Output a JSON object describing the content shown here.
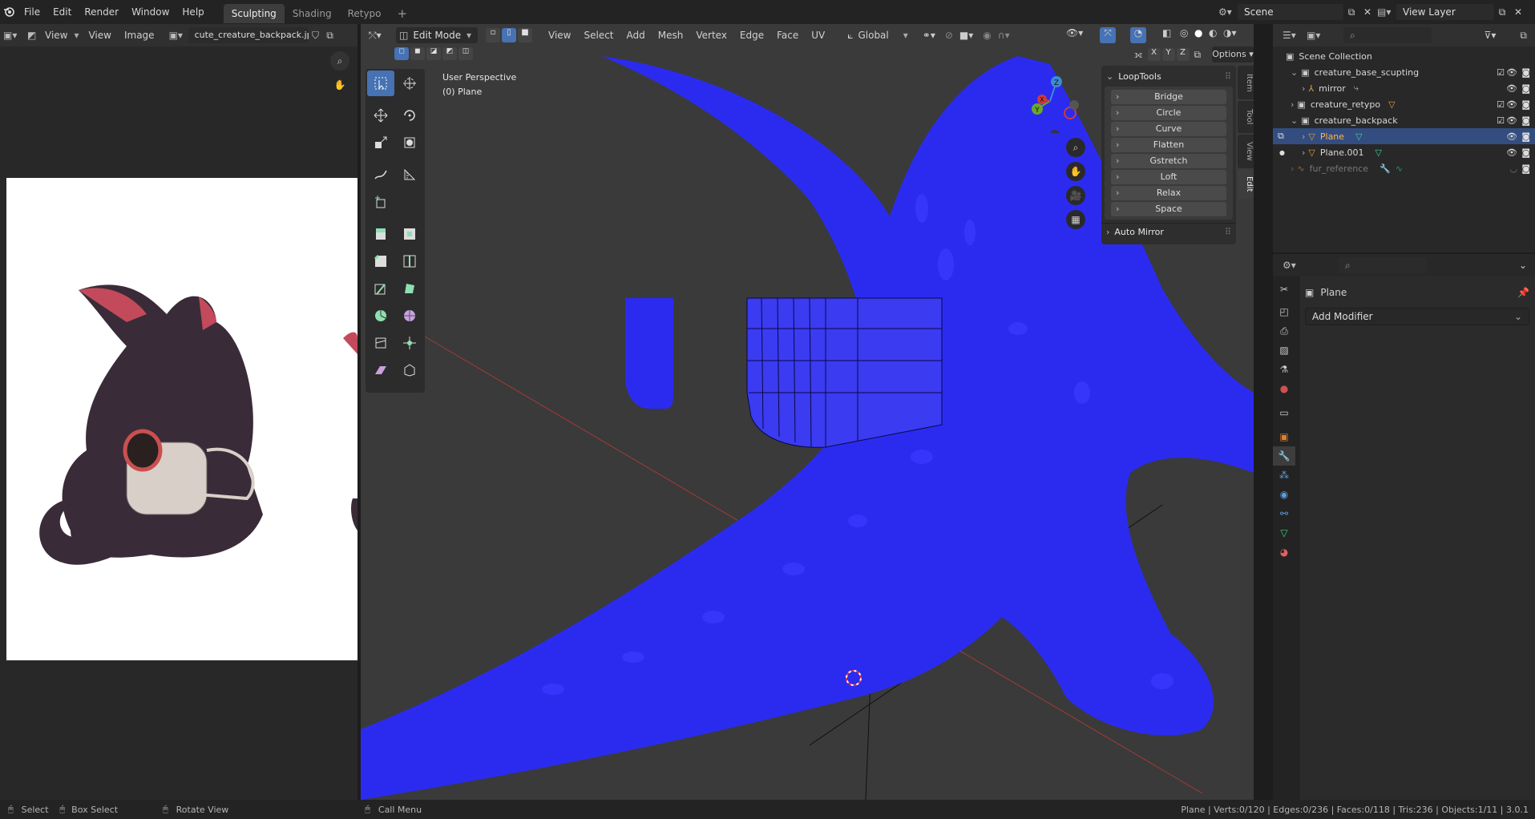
{
  "menu": {
    "items": [
      "File",
      "Edit",
      "Render",
      "Window",
      "Help"
    ]
  },
  "workspaces": [
    "Sculpting",
    "Shading",
    "Retypo"
  ],
  "scene": {
    "name": "Scene",
    "view_layer": "View Layer"
  },
  "image_editor": {
    "view": "View",
    "view2": "View",
    "image": "Image",
    "filename": "cute_creature_backpack.jpg"
  },
  "viewport": {
    "mode": "Edit Mode",
    "menus": [
      "View",
      "Select",
      "Add",
      "Mesh",
      "Vertex",
      "Edge",
      "Face",
      "UV"
    ],
    "orientation": "Global",
    "perspective": "User Perspective",
    "object": "(0) Plane",
    "options": "Options",
    "axes": [
      "X",
      "Y",
      "Z"
    ],
    "gizmo": {
      "x": "X",
      "y": "Y",
      "z": "Z"
    }
  },
  "looptools": {
    "title": "LoopTools",
    "items": [
      "Bridge",
      "Circle",
      "Curve",
      "Flatten",
      "Gstretch",
      "Loft",
      "Relax",
      "Space"
    ],
    "auto_mirror": "Auto Mirror"
  },
  "side_tabs": [
    "Item",
    "Tool",
    "View",
    "Edit"
  ],
  "outliner": {
    "root": "Scene Collection",
    "rows": [
      {
        "label": "creature_base_scupting"
      },
      {
        "label": "mirror"
      },
      {
        "label": "creature_retypo"
      },
      {
        "label": "creature_backpack"
      },
      {
        "label": "Plane"
      },
      {
        "label": "Plane.001"
      },
      {
        "label": "fur_reference"
      }
    ]
  },
  "properties": {
    "object": "Plane",
    "add_modifier": "Add Modifier"
  },
  "status": {
    "select": "Select",
    "box_select": "Box Select",
    "rotate": "Rotate View",
    "call_menu": "Call Menu",
    "stats": "Plane | Verts:0/120 | Edges:0/236 | Faces:0/118 | Tris:236 | Objects:1/11 | 3.0.1"
  },
  "colors": {
    "accent": "#4772b3",
    "mesh": "#2b2bf0",
    "bg_viewport": "#3a3a3a"
  }
}
